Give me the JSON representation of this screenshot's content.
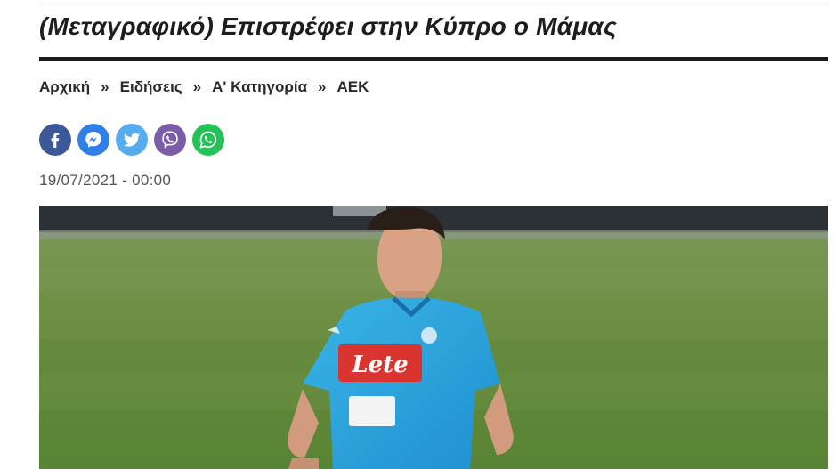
{
  "article": {
    "title": "(Μεταγραφικό) Επιστρέφει στην Κύπρο ο Μάμας",
    "date": "19/07/2021 - 00:00"
  },
  "breadcrumb": {
    "items": [
      {
        "label": "Αρχική"
      },
      {
        "label": "Ειδήσεις"
      },
      {
        "label": "Α' Κατηγορία"
      },
      {
        "label": "ΑΕΚ"
      }
    ],
    "separator": "»"
  },
  "share": {
    "buttons": [
      {
        "icon": "facebook-icon",
        "color": "#3b5998"
      },
      {
        "icon": "messenger-icon",
        "color": "#2f7fe6"
      },
      {
        "icon": "twitter-icon",
        "color": "#55acee"
      },
      {
        "icon": "viber-icon",
        "color": "#7b5ca8"
      },
      {
        "icon": "whatsapp-icon",
        "color": "#25c25a"
      }
    ]
  },
  "photo": {
    "shirt_sponsor": "Lete"
  }
}
